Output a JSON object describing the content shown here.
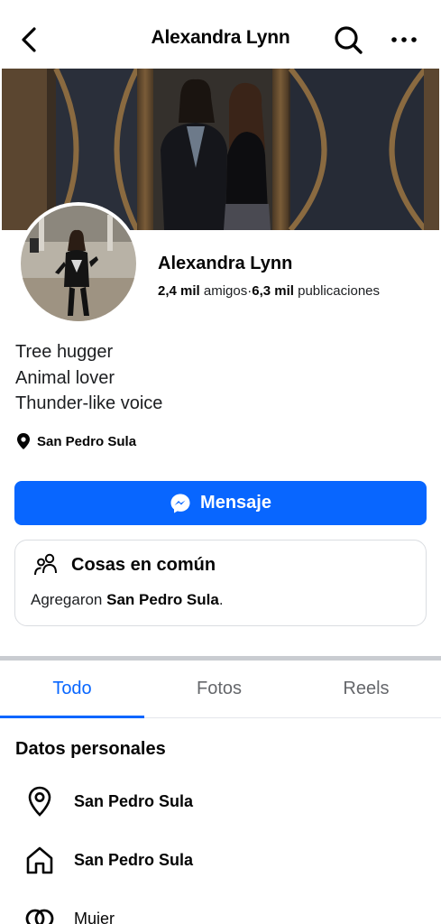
{
  "header": {
    "title": "Alexandra Lynn",
    "back_icon": "back-arrow-icon",
    "search_icon": "search-icon",
    "more_icon": "more-dots-icon"
  },
  "profile": {
    "name": "Alexandra Lynn",
    "friends_count": "2,4 mil",
    "friends_label": "amigos",
    "separator": "·",
    "posts_count": "6,3 mil",
    "posts_label": "publicaciones",
    "bio": [
      "Tree hugger",
      "Animal lover",
      "Thunder-like voice"
    ],
    "location": "San Pedro Sula"
  },
  "message_button": {
    "label": "Mensaje",
    "icon": "messenger-icon",
    "color": "#0866ff"
  },
  "common": {
    "title": "Cosas en común",
    "icon": "people-icon",
    "text_prefix": "Agregaron ",
    "text_bold": "San Pedro Sula",
    "text_suffix": "."
  },
  "tabs": [
    {
      "label": "Todo",
      "active": true
    },
    {
      "label": "Fotos",
      "active": false
    },
    {
      "label": "Reels",
      "active": false
    }
  ],
  "personal": {
    "title": "Datos personales",
    "items": [
      {
        "icon": "location-pin-icon",
        "text": "San Pedro Sula"
      },
      {
        "icon": "home-icon",
        "text": "San Pedro Sula"
      },
      {
        "icon": "gender-rings-icon",
        "text": "Mujer"
      }
    ]
  }
}
